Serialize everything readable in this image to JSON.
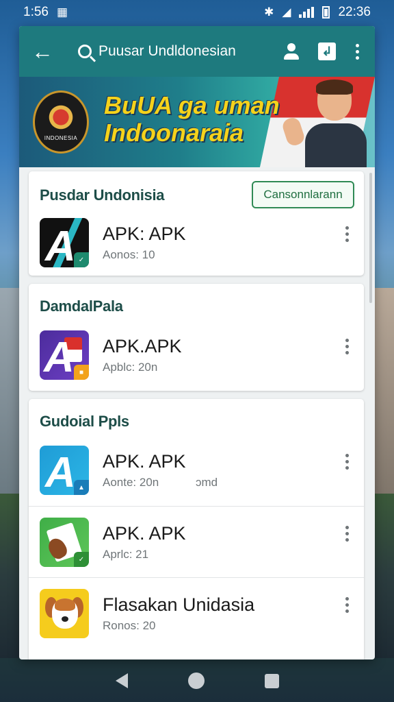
{
  "status_bar": {
    "time": "1:56",
    "clock_right": "22:36",
    "icons": [
      "image-icon",
      "bluetooth-icon",
      "wifi-icon",
      "signal-icon",
      "battery-icon"
    ]
  },
  "toolbar": {
    "search_query": "Puusar Undldonesian",
    "color": "#1e7a7e"
  },
  "banner": {
    "headline_line1": "BuUA ga uman",
    "headline_line2": "Indoonaraia",
    "logo_text": "INDONESIA"
  },
  "sections": [
    {
      "title": "Pusdar Undonisia",
      "action_label": "Cansonnlarann",
      "apps": [
        {
          "name": "APK: APK",
          "meta": "Aonos: 10"
        }
      ]
    },
    {
      "title": "DamdalPala",
      "apps": [
        {
          "name": "APK.APK",
          "meta": "Apblc: 20n"
        }
      ]
    },
    {
      "title": "Gudoial Ppls",
      "apps": [
        {
          "name": "APK. APK",
          "meta": "Aonte: 20n",
          "meta_extra": "ɔmd"
        },
        {
          "name": "APK. APK",
          "meta": "Aprlc: 21"
        },
        {
          "name": "Flasakan Unidasia",
          "meta": "Ronos: 20"
        }
      ]
    }
  ],
  "colors": {
    "accent": "#1e7a7e",
    "action_border": "#2f8a55",
    "title_text": "#1d4d48"
  }
}
